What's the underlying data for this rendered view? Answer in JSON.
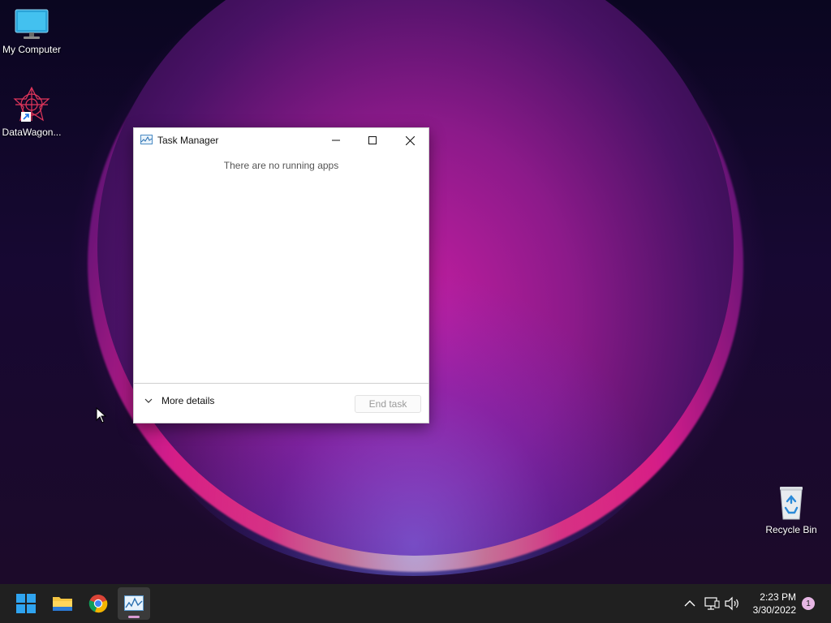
{
  "desktop": {
    "icons": [
      {
        "label": "My Computer",
        "icon": "monitor-icon"
      },
      {
        "label": "DataWagon...",
        "icon": "datawagon-shortcut-icon"
      },
      {
        "label": "Recycle Bin",
        "icon": "recycle-bin-icon"
      }
    ]
  },
  "window": {
    "title": "Task Manager",
    "message": "There are no running apps",
    "more_details_label": "More details",
    "end_task_label": "End task",
    "controls": [
      "minimize-icon",
      "maximize-icon",
      "close-icon"
    ]
  },
  "taskbar": {
    "apps": [
      {
        "name": "Start",
        "icon": "windows-start-icon"
      },
      {
        "name": "File Explorer",
        "icon": "folder-icon"
      },
      {
        "name": "Google Chrome",
        "icon": "chrome-icon"
      },
      {
        "name": "Task Manager",
        "icon": "task-manager-icon",
        "active": true
      }
    ],
    "tray": {
      "icons": [
        "chevron-up-icon",
        "network-icon",
        "volume-icon"
      ],
      "time": "2:23 PM",
      "date": "3/30/2022",
      "notification_count": "1"
    }
  },
  "colors": {
    "taskbar_bg": "#202020",
    "active_indicator": "#d99ad2",
    "notification_badge": "#e6b6e4"
  }
}
